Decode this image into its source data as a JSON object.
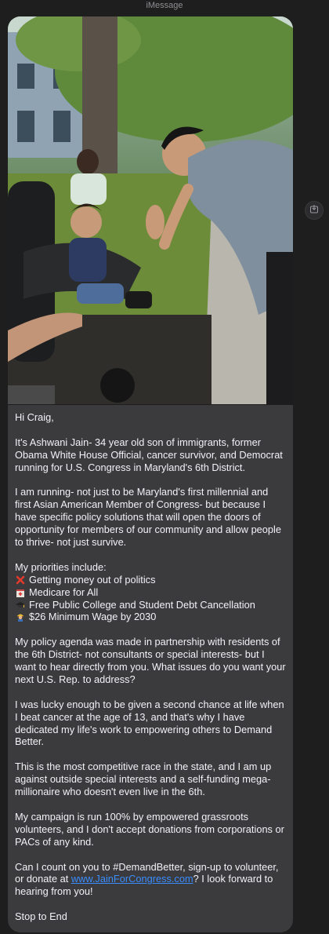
{
  "header": {
    "service": "iMessage"
  },
  "message": {
    "greeting": "Hi Craig,",
    "intro": "It's Ashwani Jain- 34 year old son of immigrants, former Obama White House Official, cancer survivor, and Democrat running for U.S. Congress in Maryland's 6th District.",
    "running": "I am running- not just to be Maryland's first millennial and first Asian American Member of Congress- but because I have specific policy solutions that will open the doors of opportunity for members of our community and allow people to thrive- not just survive.",
    "priorities_header": "My priorities include:",
    "priorities": [
      {
        "icon": "red-x-icon",
        "text": "Getting money out of politics"
      },
      {
        "icon": "hospital-icon",
        "text": "Medicare for All"
      },
      {
        "icon": "graduation-cap-icon",
        "text": "Free Public College and Student Debt Cancellation"
      },
      {
        "icon": "worker-icon",
        "text": "$26 Minimum Wage by 2030"
      }
    ],
    "agenda": "My policy agenda was made in partnership with residents of the 6th District- not consultants or special interests- but I want to hear directly from you. What issues do you want your next U.S. Rep. to address?",
    "lucky": "I was lucky enough to be given a second chance at life when I beat cancer at the age of 13, and that's why I have dedicated my life's work to empowering others to Demand Better.",
    "competitive": "This is the most competitive race in the state, and I am up against outside special interests and a self-funding mega-millionaire who doesn't even live in the 6th.",
    "campaign": "My campaign is run 100% by empowered grassroots volunteers, and I don't accept donations from corporations or PACs of any kind.",
    "cta_before": "Can I count on you to #DemandBetter, sign-up to volunteer, or donate at ",
    "cta_link": "www.JainForCongress.com",
    "cta_after": "? I look forward to hearing from you!",
    "stop": "Stop to End"
  }
}
